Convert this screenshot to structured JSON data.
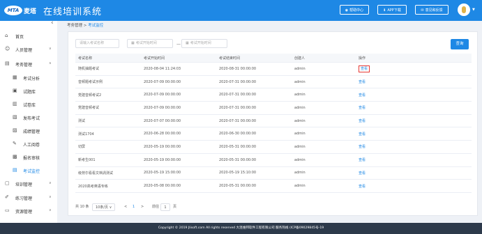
{
  "header": {
    "logo_badge": "MTA",
    "logo_text": "麦塔",
    "title": "在线培训系统",
    "help_label": "帮助中心",
    "app_label": "APP下载",
    "feedback_label": "意见和反馈"
  },
  "sidebar": {
    "collapse_icon": "chevron-left-icon",
    "items": [
      {
        "label": "首页",
        "icon": "home-icon"
      },
      {
        "label": "人员管理",
        "icon": "user-icon"
      },
      {
        "label": "考务管理",
        "icon": "exam-icon"
      },
      {
        "label": "考试分析",
        "icon": "analysis-icon"
      },
      {
        "label": "试题库",
        "icon": "question-bank-icon"
      },
      {
        "label": "试卷库",
        "icon": "paper-bank-icon"
      },
      {
        "label": "发布考试",
        "icon": "publish-icon"
      },
      {
        "label": "成绩管理",
        "icon": "score-icon"
      },
      {
        "label": "人工阅卷",
        "icon": "grading-icon"
      },
      {
        "label": "报名审核",
        "icon": "review-icon"
      },
      {
        "label": "考试监控",
        "icon": "monitor-icon"
      },
      {
        "label": "培训管理",
        "icon": "training-icon"
      },
      {
        "label": "练习管理",
        "icon": "practice-icon"
      },
      {
        "label": "资源管理",
        "icon": "resource-icon"
      }
    ]
  },
  "breadcrumb": {
    "parent": "考务管理",
    "separator": ">",
    "current": "考试监控"
  },
  "search": {
    "name_placeholder": "请输入考试名称",
    "start_placeholder": "考试开始时间",
    "end_placeholder": "考试开始时间",
    "range_sep": "—",
    "query_label": "查询"
  },
  "table": {
    "headers": [
      "考试名称",
      "考试开始时间",
      "考试结束时间",
      "创建人",
      "操作"
    ],
    "rows": [
      [
        "随机抽题考试",
        "2020-08-04 11:24:03",
        "2020-08-31 00:00:00",
        "admin",
        "查看"
      ],
      [
        "音频题考试示例",
        "2020-07-09 00:00:00",
        "2020-07-31 00:00:00",
        "admin",
        "查看"
      ],
      [
        "党建音频考试2",
        "2020-07-09 00:00:00",
        "2020-07-31 00:00:00",
        "admin",
        "查看"
      ],
      [
        "党建音频考试",
        "2020-07-09 00:00:00",
        "2020-07-31 00:00:00",
        "admin",
        "查看"
      ],
      [
        "测试",
        "2020-07-07 00:00:00",
        "2020-07-31 00:00:00",
        "admin",
        "查看"
      ],
      [
        "测试1704",
        "2020-06-28 00:00:00",
        "2020-06-30 00:00:00",
        "admin",
        "查看"
      ],
      [
        "切屏",
        "2020-05-19 00:00:00",
        "2020-05-31 00:00:00",
        "admin",
        "查看"
      ],
      [
        "新考生001",
        "2020-05-19 00:00:00",
        "2020-05-31 00:00:00",
        "admin",
        "查看"
      ],
      [
        "级劳尔看看文档涡测试",
        "2020-05-19 15:00:00",
        "2020-05-19 15:10:00",
        "admin",
        "查看"
      ],
      [
        "2020高考英语专练",
        "2020-05-08 00:00:00",
        "2020-05-31 00:00:00",
        "admin",
        "查看"
      ]
    ]
  },
  "pager": {
    "total": "共 10 条",
    "page_size": "10条/页",
    "prev": "<",
    "current": "1",
    "next": ">",
    "goto_prefix": "前往",
    "goto_value": "1",
    "goto_suffix": "页"
  },
  "footer": {
    "text": "Copyright © 2019 Jlisoft.com All rights reserved 大连维邦软件工程有限公司 服务热线 (ICP备09029845号-19"
  }
}
